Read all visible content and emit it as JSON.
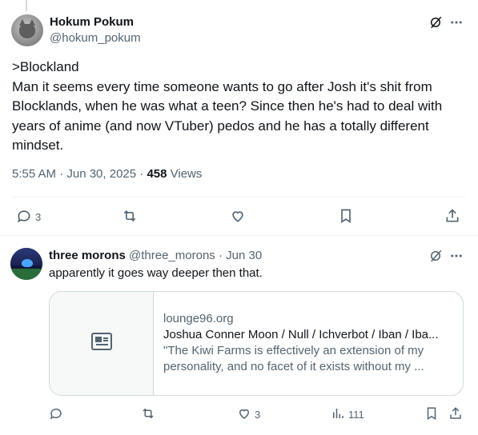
{
  "main_tweet": {
    "author_name": "Hokum Pokum",
    "author_handle": "@hokum_pokum",
    "text_lines": [
      ">Blockland",
      "Man it seems every time someone wants to go after Josh it's shit from",
      "Blocklands, when he was what a teen? Since then he's had to deal with",
      "years of anime (and now VTuber) pedos and he has a totally different",
      "mindset."
    ],
    "time": "5:55 AM · Jun 30, 2025 · ",
    "views_count": "458",
    "views_label": " Views",
    "actions": {
      "reply_count": "3",
      "retweet_count": "",
      "like_count": ""
    }
  },
  "reply_tweet": {
    "author_name": "three morons",
    "author_handle": "@three_morons",
    "separator": "·",
    "date": "Jun 30",
    "text": "apparently it goes way deeper then that.",
    "card": {
      "domain": "lounge96.org",
      "title": "Joshua Conner Moon / Null / Ichverbot / Iban / Iba...",
      "desc_lines": [
        "\"The Kiwi Farms is effectively an extension of my",
        "personality, and no facet of it exists without my ..."
      ]
    },
    "actions": {
      "like_count": "3",
      "views_count": "111"
    }
  },
  "icons": [
    "grok-icon",
    "more-icon",
    "reply-icon",
    "retweet-icon",
    "like-icon",
    "bookmark-icon",
    "share-icon",
    "views-icon",
    "article-icon"
  ],
  "colors": {
    "text": "#0f1419",
    "muted": "#536471",
    "border": "#cfd9de"
  }
}
